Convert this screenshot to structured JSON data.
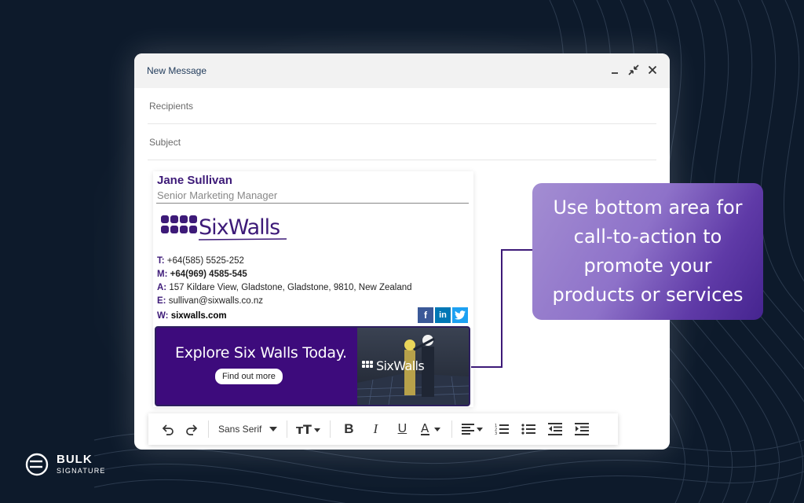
{
  "compose": {
    "title": "New Message",
    "recipients_placeholder": "Recipients",
    "subject_placeholder": "Subject"
  },
  "signature": {
    "name": "Jane Sullivan",
    "job_title": "Senior Marketing Manager",
    "logo_text": "SixWalls",
    "phone_label": "T:",
    "phone": "+64(585) 5525-252",
    "mobile_label": "M:",
    "mobile": "+64(969) 4585-545",
    "address_label": "A:",
    "address": "157 Kildare View, Gladstone, Gladstone, 9810, New Zealand",
    "email_label": "E:",
    "email": "sullivan@sixwalls.co.nz",
    "web_label": "W:",
    "web": "sixwalls.com",
    "socials": [
      "facebook-icon",
      "linkedin-icon",
      "twitter-icon"
    ],
    "brand_color": "#3d1a78"
  },
  "banner": {
    "headline": "Explore Six Walls Today.",
    "button_label": "Find out more",
    "photo_logo_text": "SixWalls",
    "background": "#3d0b7c"
  },
  "toolbar": {
    "font_family_value": "Sans Serif",
    "icons": [
      "undo-icon",
      "redo-icon",
      "font-size-icon",
      "bold-icon",
      "italic-icon",
      "underline-icon",
      "text-color-icon",
      "align-icon",
      "numbered-list-icon",
      "bulleted-list-icon",
      "indent-less-icon",
      "indent-more-icon"
    ]
  },
  "callout": {
    "text": "Use bottom area for call-to-action to promote your products or services"
  },
  "brand": {
    "name": "BULK",
    "subtitle": "SIGNATURE"
  }
}
